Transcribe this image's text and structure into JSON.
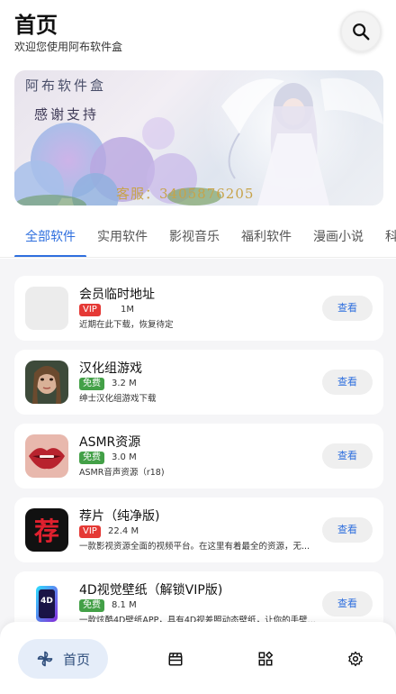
{
  "header": {
    "title": "首页",
    "subtitle": "欢迎您使用阿布软件盒"
  },
  "banner": {
    "title": "阿布软件盒",
    "thanks": "感谢支持",
    "qq": "客服：3405876205"
  },
  "tabs": [
    {
      "label": "全部软件"
    },
    {
      "label": "实用软件"
    },
    {
      "label": "影视音乐"
    },
    {
      "label": "福利软件"
    },
    {
      "label": "漫画小说"
    },
    {
      "label": "科"
    }
  ],
  "apps": [
    {
      "name": "会员临时地址",
      "badge": "VIP",
      "size": "1M",
      "desc": "近期在此下载，恢复待定",
      "action": "查看"
    },
    {
      "name": "汉化组游戏",
      "badge": "免费",
      "size": "3.2 M",
      "desc": "绅士汉化组游戏下载",
      "action": "查看"
    },
    {
      "name": "ASMR资源",
      "badge": "免费",
      "size": "3.0 M",
      "desc": "ASMR音声资源（r18)",
      "action": "查看"
    },
    {
      "name": "荐片（纯净版)",
      "badge": "VIP",
      "size": "22.4 M",
      "desc": "一款影视资源全面的视频平台。在这里有着最全的资源，无...",
      "action": "查看",
      "icon_char": "荐"
    },
    {
      "name": "4D视觉壁纸（解锁VIP版)",
      "badge": "免费",
      "size": "8.1 M",
      "desc": "一款炫酷4D壁纸APP，具有4D视差照动态壁纸，让你的手壁...",
      "action": "查看",
      "icon_text": "4D"
    }
  ],
  "bottom_nav": {
    "home_label": "首页"
  },
  "colors": {
    "accent": "#2f6fde",
    "vip": "#e53935",
    "free": "#43a047"
  }
}
